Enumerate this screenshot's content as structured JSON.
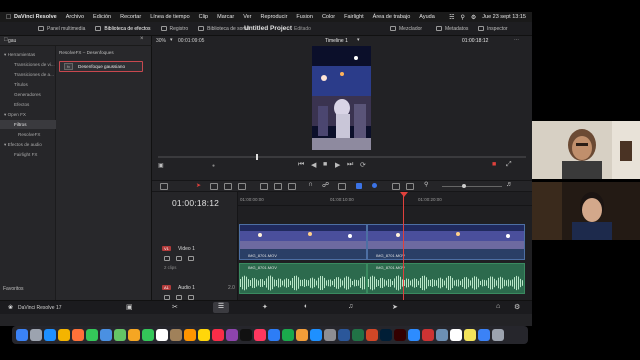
{
  "menubar": {
    "app_name": "DaVinci Resolve",
    "items": [
      "Archivo",
      "Edición",
      "Recortar",
      "Línea de tiempo",
      "Clip",
      "Marcar",
      "Ver",
      "Reproducir",
      "Fusion",
      "Color",
      "Fairlight",
      "Área de trabajo",
      "Ayuda"
    ],
    "clock": "Jue 23 sept  13:15"
  },
  "toolbar": {
    "media_pool": "Panel multimedia",
    "effects_library": "Biblioteca de efectos",
    "edit_index": "Registro",
    "sound_library": "Biblioteca de sonid",
    "project_title": "Untitled Project",
    "project_state": "Editado",
    "mixer": "Mezclador",
    "metadata": "Metadatos",
    "inspector": "Inspector"
  },
  "effects": {
    "search_value": "gau",
    "tree": [
      "Herramientas",
      "Transiciones de vi...",
      "Transiciones de a...",
      "Títulos",
      "Generadores",
      "Efectos",
      "Open FX",
      "Filtros",
      "ResolveFX",
      "Efectos de audio",
      "Fairlight FX"
    ],
    "selected_tree_item": "Filtros",
    "list_header": "ResolveFX – Desenfoques",
    "result": "Desenfoque gaussiano",
    "favorites": "Favoritos"
  },
  "viewer": {
    "zoom": "30%",
    "source_timecode": "00:01:09:05",
    "timeline_name": "Timeline 1",
    "record_timecode": "01:00:18:12"
  },
  "timeline": {
    "timecode": "01:00:18:12",
    "ruler_labels": [
      "01:00:00:00",
      "01:00:10:00",
      "01:00:20:00"
    ],
    "video_track": {
      "badge": "V1",
      "name": "Video 1",
      "clip_count": "2 clips"
    },
    "audio_track": {
      "badge": "A1",
      "name": "Audio 1",
      "channel": "2.0",
      "level": "2.0"
    },
    "clips": [
      "IMG_8701.MOV",
      "IMG_8701.MOV"
    ],
    "playhead_fraction": 0.56
  },
  "pages_bar": {
    "app_label": "DaVinci Resolve 17",
    "tabs": [
      "media",
      "cut",
      "edit",
      "fusion",
      "color",
      "fairlight",
      "deliver"
    ],
    "active_tab": "edit"
  },
  "colors": {
    "accent_red": "#e0413c",
    "clip_blue": "#2a3f66",
    "clip_green": "#2c6a4d",
    "selection_border": "#c8484f"
  },
  "dock": {
    "apps": [
      "finder-icon",
      "launchpad-icon",
      "safari-icon",
      "chrome-icon",
      "firefox-icon",
      "messages-icon",
      "mail-icon",
      "maps-icon",
      "photos-icon",
      "facetime-icon",
      "calendar-icon",
      "contacts-icon",
      "reminders-icon",
      "notes-icon",
      "music-icon",
      "podcasts-icon",
      "tv-icon",
      "news-icon",
      "keynote-icon",
      "numbers-icon",
      "pages-icon",
      "appstore-icon",
      "settings-icon",
      "word-icon",
      "excel-icon",
      "powerpoint-icon",
      "photoshop-icon",
      "illustrator-icon",
      "zoom-icon",
      "resolve-icon",
      "preview-icon",
      "textedit-icon",
      "notes-2-icon",
      "downloads-icon",
      "trash-icon"
    ]
  }
}
